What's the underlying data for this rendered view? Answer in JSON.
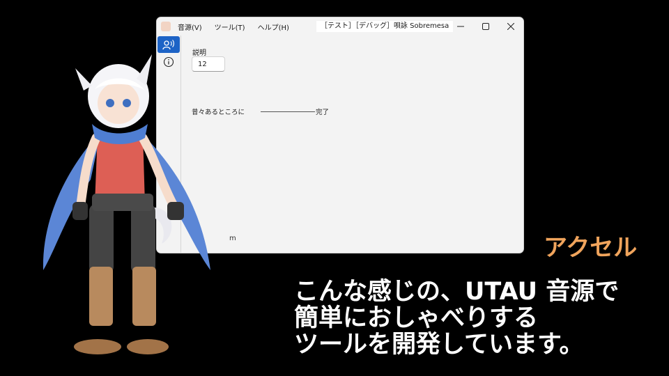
{
  "window": {
    "menu": [
      "音源(V)",
      "ツール(T)",
      "ヘルプ(H)"
    ],
    "title": "［テスト］［デバッグ］唄詠 Sobremesa",
    "controls": [
      "minimize-icon",
      "maximize-icon",
      "close-icon"
    ]
  },
  "sidebar": {
    "items": [
      {
        "icon": "voice-speak-icon",
        "active": true
      },
      {
        "icon": "info-icon",
        "active": false
      }
    ]
  },
  "content": {
    "description_label": "説明",
    "description_value": "12",
    "row_text_left": "昔々あるところに",
    "row_text_right": "完了",
    "fragment": "m"
  },
  "overlay": {
    "speaker": "アクセル",
    "caption_lines": [
      "こんな感じの、UTAU 音源で",
      "簡単におしゃべりする",
      "ツールを開発しています。"
    ]
  },
  "colors": {
    "background": "#000000",
    "speaker": "#f0a45c",
    "caption": "#ffffff",
    "accent": "#1d63c6"
  }
}
